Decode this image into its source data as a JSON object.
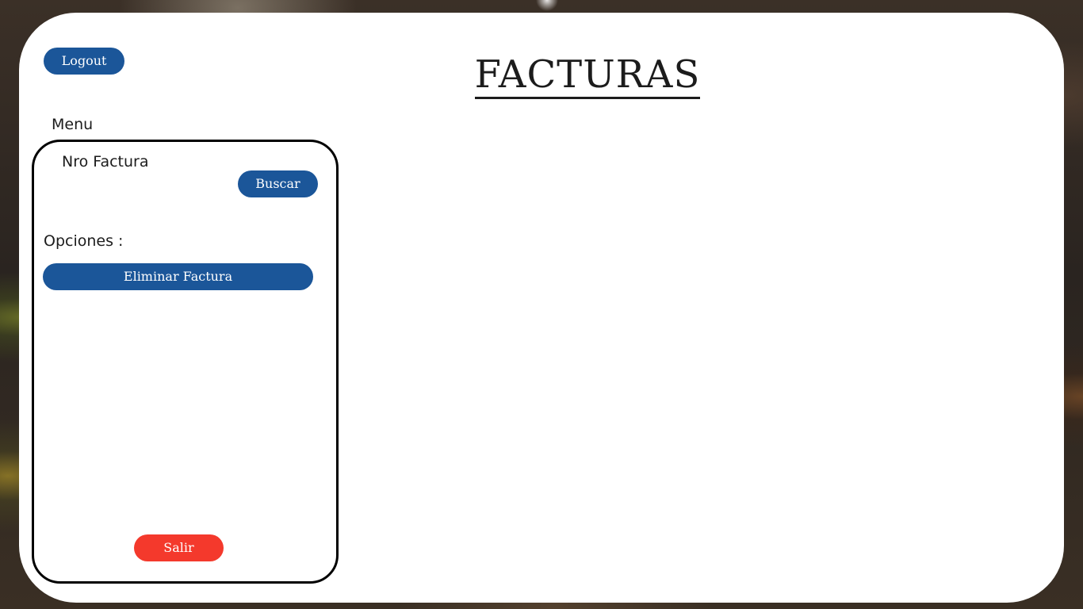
{
  "header": {
    "logout_label": "Logout",
    "title": "FACTURAS"
  },
  "menu": {
    "label": "Menu",
    "search": {
      "field_label": "Nro Factura",
      "button_label": "Buscar"
    },
    "options": {
      "label": "Opciones :",
      "delete_label": "Eliminar Factura"
    },
    "exit_label": "Salir"
  },
  "colors": {
    "primary_button": "#1b5699",
    "exit_button": "#f4392c",
    "card": "#ffffff",
    "text": "#1c1c1c"
  }
}
